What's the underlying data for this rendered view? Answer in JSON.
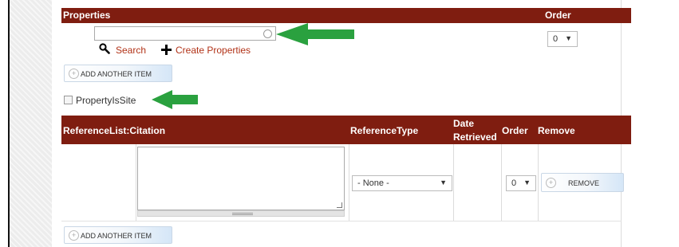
{
  "properties_section": {
    "header_label": "Properties",
    "order_label": "Order",
    "search_input_value": "",
    "search_link": "Search",
    "create_link": "Create Properties",
    "order_value": "0",
    "add_another_label": "ADD ANOTHER ITEM"
  },
  "property_is_site": {
    "label": "PropertyIsSite",
    "checked": false
  },
  "reference_section": {
    "columns": {
      "citation": "ReferenceList:Citation",
      "reference_type": "ReferenceType",
      "date_retrieved_line1": "Date",
      "date_retrieved_line2": "Retrieved",
      "order": "Order",
      "remove": "Remove"
    },
    "row": {
      "citation_text": "",
      "reference_type_value": "- None -",
      "order_value": "0",
      "remove_label": "REMOVE"
    },
    "add_another_label": "ADD ANOTHER ITEM"
  },
  "colors": {
    "header_bg": "#7f1d10",
    "link": "#b13217",
    "arrow": "#2aa13f"
  },
  "icons": [
    "search-icon",
    "plus-icon",
    "chevron-down-icon",
    "add-circle-icon",
    "spinner-icon"
  ]
}
